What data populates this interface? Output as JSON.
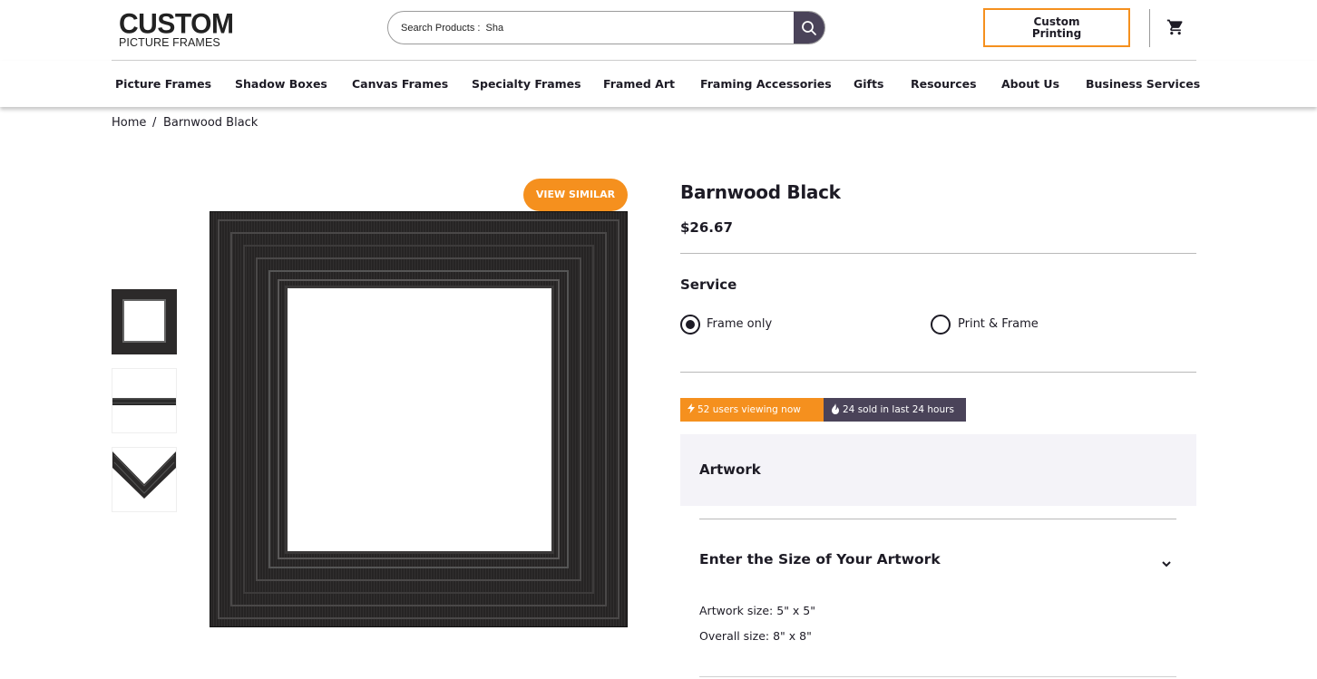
{
  "header": {
    "logo_line1": "CUSTOM",
    "logo_line2": "PICTURE FRAMES",
    "search_value": "Search Products :  Sha",
    "custom_printing_label_1": "Custom",
    "custom_printing_label_2": "Printing"
  },
  "nav": {
    "items": [
      "Picture Frames",
      "Shadow Boxes",
      "Canvas Frames",
      "Specialty Frames",
      "Framed Art",
      "Framing Accessories",
      "Gifts",
      "Resources",
      "About Us",
      "Business Services"
    ]
  },
  "breadcrumb": {
    "home": "Home",
    "separator": "/",
    "current": "Barnwood Black"
  },
  "gallery": {
    "view_similar": "VIEW SIMILAR"
  },
  "product": {
    "title": "Barnwood Black",
    "price": "$26.67",
    "service_label": "Service",
    "options": [
      {
        "label": "Frame only",
        "selected": true
      },
      {
        "label": "Print & Frame",
        "selected": false
      }
    ],
    "viewing_badge": "52 users viewing now",
    "sold_badge": "24 sold in last 24 hours",
    "artwork_heading": "Artwork",
    "size_heading": "Enter the Size of Your Artwork",
    "artwork_size": "Artwork size: 5\" x 5\"",
    "overall_size": "Overall size: 8\" x 8\""
  },
  "colors": {
    "accent": "#f5901e",
    "dark": "#4a4359",
    "text": "#1d1b25",
    "panel": "#f4f3f8"
  }
}
